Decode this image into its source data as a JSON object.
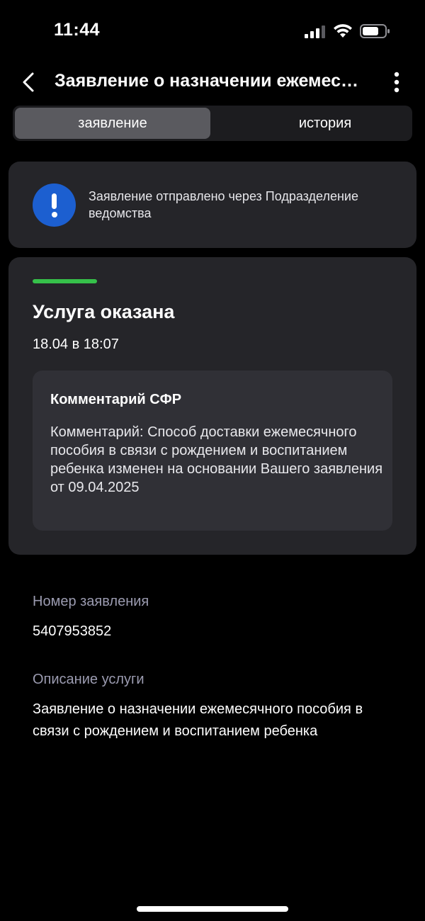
{
  "status_bar": {
    "time": "11:44"
  },
  "header": {
    "title": "Заявление о назначении ежемесячного пособия в связи с рождением и воспитанием ребенка"
  },
  "tabs": [
    {
      "label": "заявление",
      "active": true
    },
    {
      "label": "история",
      "active": false
    }
  ],
  "info_card": {
    "icon": "exclamation-circle-icon",
    "icon_color": "#1c5fd0",
    "text": "Заявление отправлено через Подразделение ведомства"
  },
  "status_card": {
    "progress_fraction": 1.0,
    "progress_color": "#36c14a",
    "title": "Услуга оказана",
    "date": "18.04 в 18:07",
    "comment_title": "Комментарий СФР",
    "comment_body": "Комментарий: Способ доставки ежемесячного пособия в связи с рождением и воспитанием ребенка изменен на основании Вашего заявления от 09.04.2025"
  },
  "details": {
    "number_label": "Номер заявления",
    "number_value": "5407953852",
    "description_label": "Описание услуги",
    "description_value": "Заявление о назначении ежемесячного пособия в связи с рождением и воспитанием ребенка"
  }
}
